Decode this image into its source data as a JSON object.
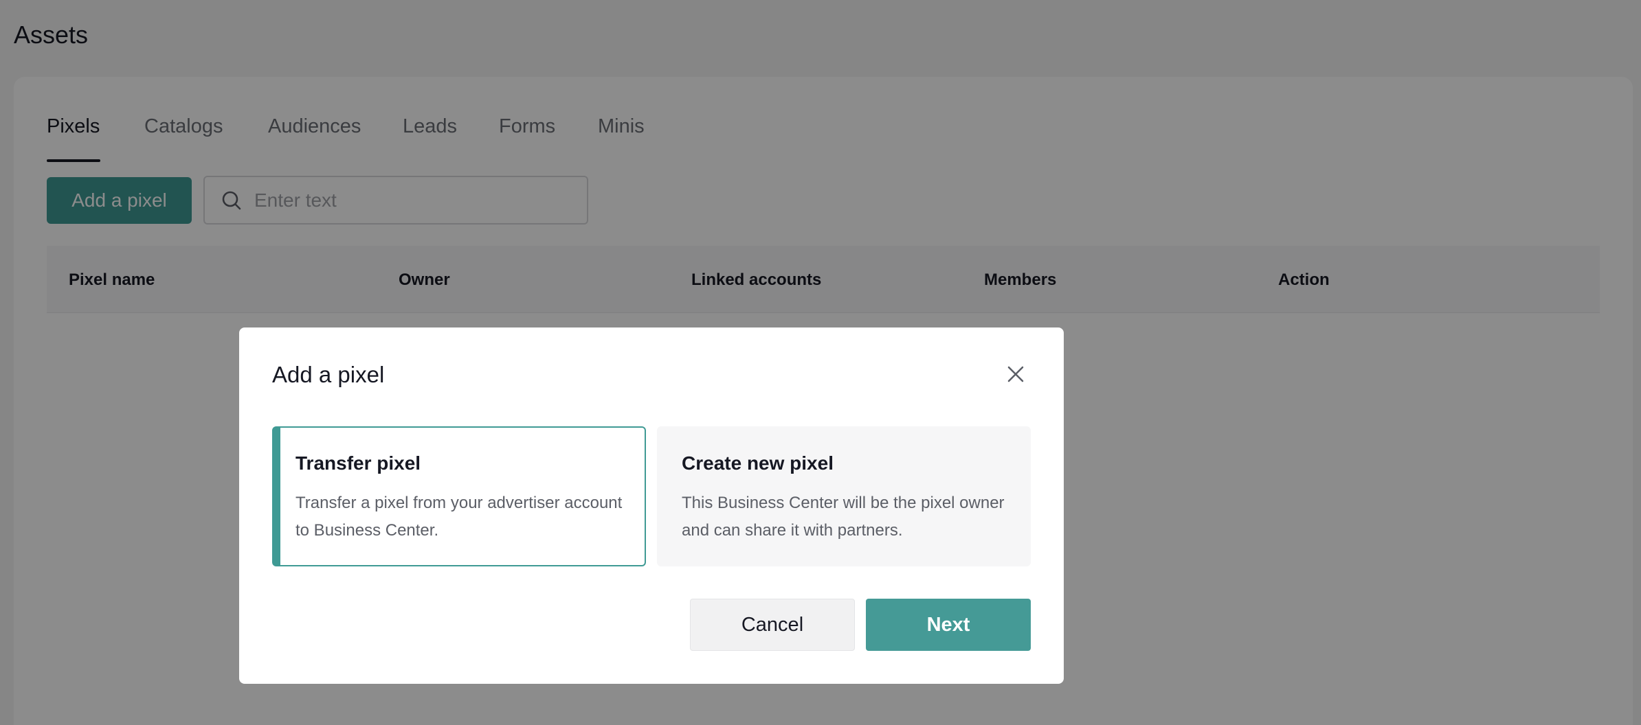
{
  "page": {
    "title": "Assets"
  },
  "tabs": [
    {
      "label": "Pixels",
      "active": true
    },
    {
      "label": "Catalogs",
      "active": false
    },
    {
      "label": "Audiences",
      "active": false
    },
    {
      "label": "Leads",
      "active": false
    },
    {
      "label": "Forms",
      "active": false
    },
    {
      "label": "Minis",
      "active": false
    }
  ],
  "toolbar": {
    "add_label": "Add a pixel",
    "search_placeholder": "Enter text",
    "search_icon": "search-icon"
  },
  "table": {
    "columns": [
      "Pixel name",
      "Owner",
      "Linked accounts",
      "Members",
      "Action"
    ]
  },
  "modal": {
    "title": "Add a pixel",
    "close_icon": "close-icon",
    "options": [
      {
        "title": "Transfer pixel",
        "description": "Transfer a pixel from your advertiser account to Business Center.",
        "selected": true
      },
      {
        "title": "Create new pixel",
        "description": "This Business Center will be the pixel owner and can share it with partners.",
        "selected": false
      }
    ],
    "cancel_label": "Cancel",
    "next_label": "Next"
  },
  "colors": {
    "accent": "#3f9a94",
    "text": "#161823",
    "overlay": "rgba(0,0,0,0.45)"
  }
}
